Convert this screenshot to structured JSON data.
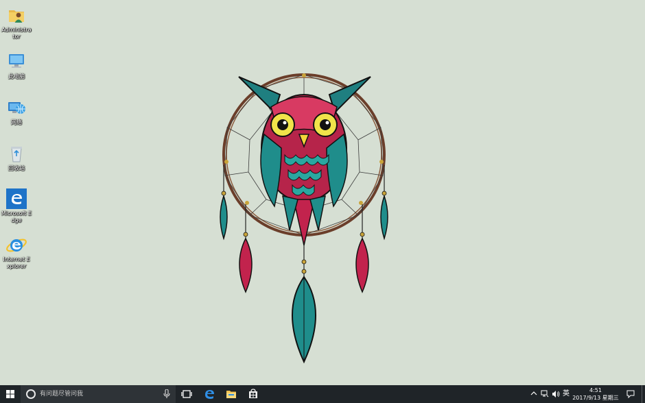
{
  "desktop": {
    "icons": [
      {
        "label": "Administrator",
        "icon": "user-folder-icon"
      },
      {
        "label": "此电脑",
        "icon": "this-pc-icon"
      },
      {
        "label": "网络",
        "icon": "network-icon"
      },
      {
        "label": "回收站",
        "icon": "recycle-bin-icon"
      },
      {
        "label": "Microsoft Edge",
        "icon": "edge-icon"
      },
      {
        "label": "Internet Explorer",
        "icon": "internet-explorer-icon"
      }
    ],
    "wallpaper": "owl-dreamcatcher-wallpaper",
    "background_color": "#d6dfd3"
  },
  "taskbar": {
    "search_placeholder": "有问题尽管问我",
    "pinned": [
      {
        "name": "task-view-icon"
      },
      {
        "name": "edge-icon"
      },
      {
        "name": "file-explorer-icon"
      },
      {
        "name": "store-icon"
      }
    ],
    "tray": {
      "language": "英",
      "time": "4:51",
      "date": "2017/9/13 星期三"
    },
    "colors": {
      "background": "#1f2428",
      "search_background": "#2e3337",
      "accent": "#0078d7"
    }
  }
}
